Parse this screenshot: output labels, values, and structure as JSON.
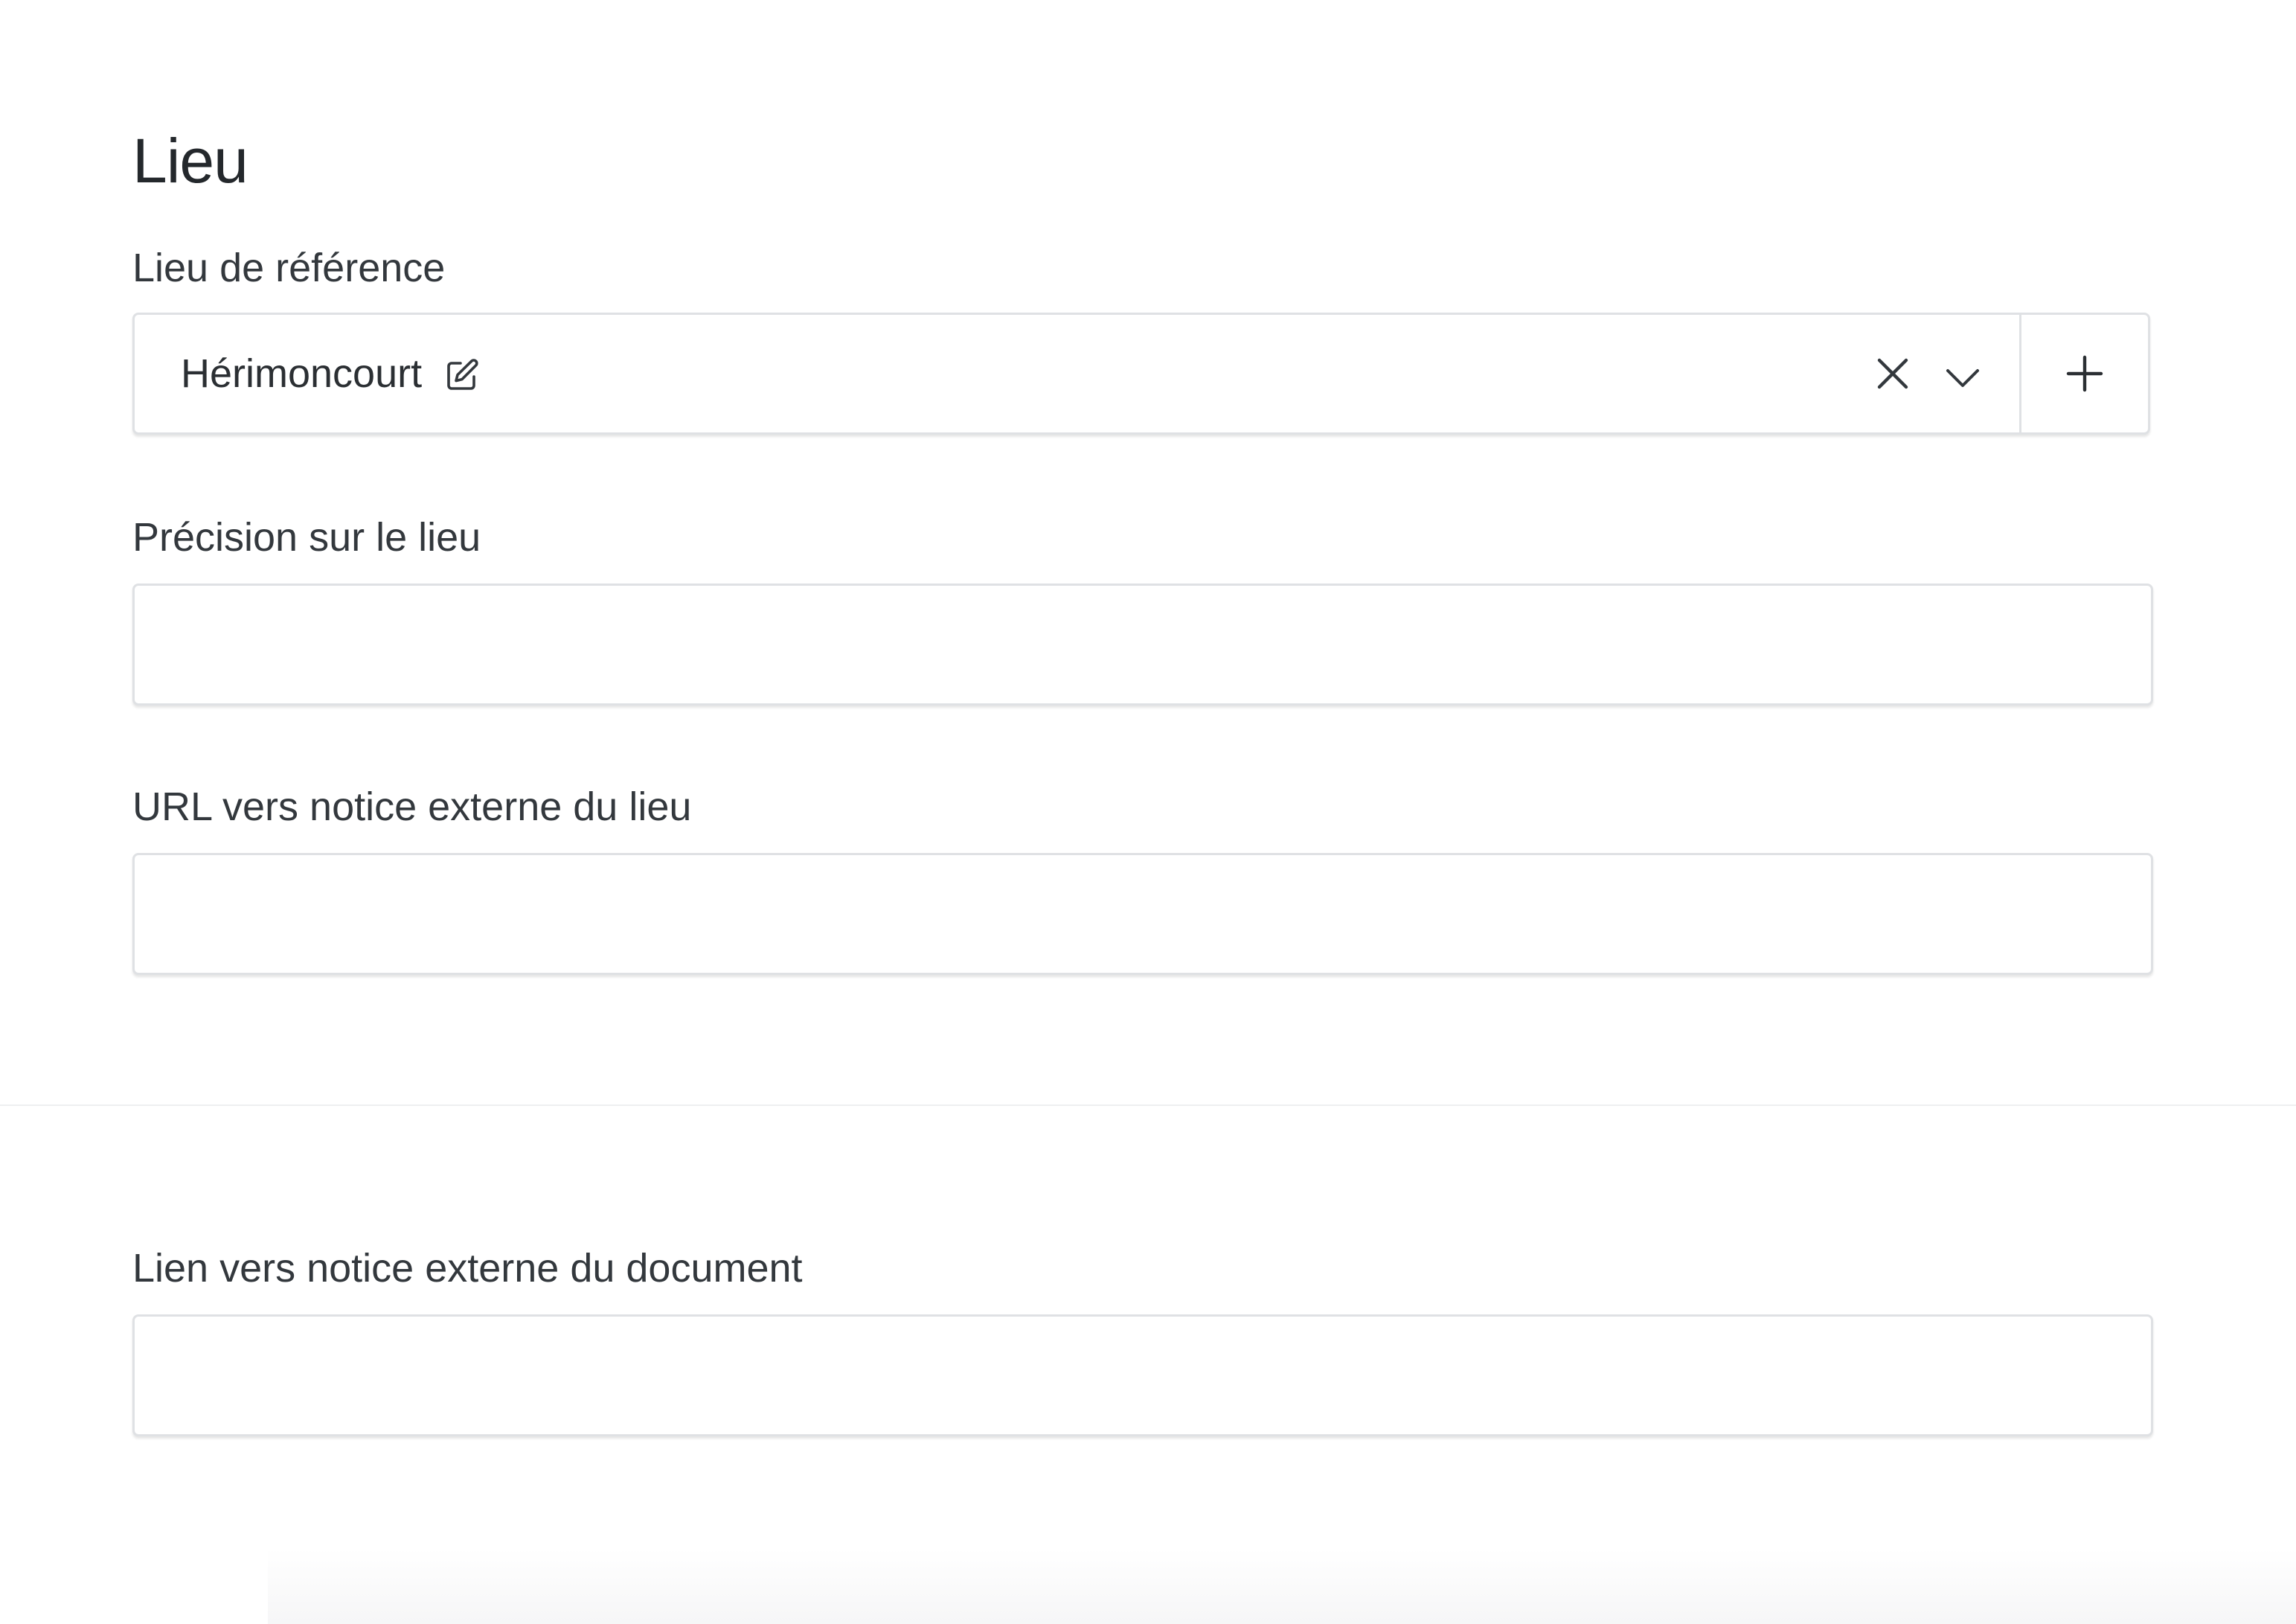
{
  "place_section": {
    "title": "Lieu",
    "reference_place": {
      "label": "Lieu de référence",
      "selected_value": "Hérimoncourt",
      "icons": {
        "edit": "edit-icon",
        "clear": "close-icon",
        "expand": "chevron-down-icon",
        "add": "plus-icon"
      }
    },
    "place_precision": {
      "label": "Précision sur le lieu",
      "value": ""
    },
    "place_external_url": {
      "label": "URL vers notice externe du lieu",
      "value": ""
    }
  },
  "document_section": {
    "external_link": {
      "label": "Lien vers notice externe du document",
      "value": ""
    }
  },
  "colors": {
    "text": "#2b2f33",
    "border": "#dfe1e4",
    "background": "#ffffff",
    "divider": "#eeeff1"
  }
}
